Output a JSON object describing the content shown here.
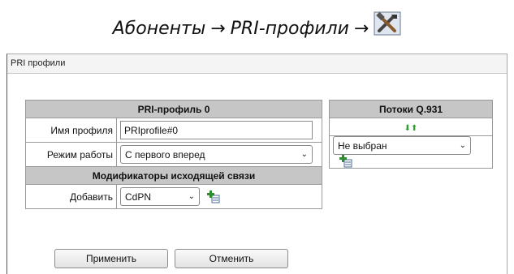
{
  "doc_caption": {
    "part1": "Абоненты",
    "arrow1": "→",
    "part2": "PRI-профили",
    "arrow2": "→",
    "icon": "tools-icon"
  },
  "panel": {
    "title": "PRI профили"
  },
  "profile_table": {
    "header": "PRI-профиль 0",
    "name_label": "Имя профиля",
    "name_value": "PRIprofile#0",
    "mode_label": "Режим работы",
    "mode_value": "С первого вперед",
    "modifiers_header": "Модификаторы исходящей связи",
    "add_label": "Добавить",
    "add_value": "CdPN"
  },
  "streams_table": {
    "header": "Потоки Q.931",
    "arrows_icons": [
      "arrow-down-icon",
      "arrow-up-icon"
    ],
    "select_value": "Не выбран"
  },
  "buttons": {
    "apply": "Применить",
    "cancel": "Отменить"
  },
  "colors": {
    "table_header_bg": "#c6c6c6",
    "arrows": "#2aa02a",
    "add_icon_plus": "#2e8b2e"
  }
}
